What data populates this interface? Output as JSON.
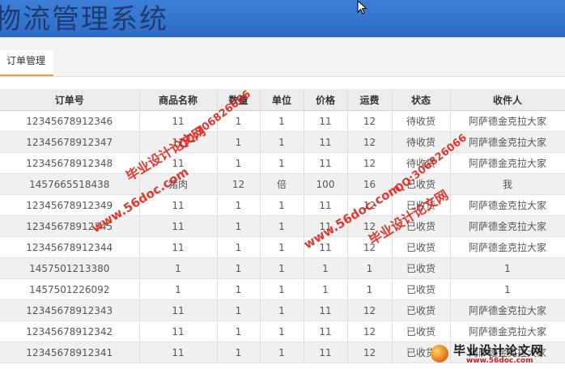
{
  "app": {
    "title": "物流管理系统"
  },
  "tabs": [
    {
      "label": "订单管理"
    }
  ],
  "table": {
    "columns": [
      "订单号",
      "商品名称",
      "数量",
      "单位",
      "价格",
      "运费",
      "状态",
      "收件人"
    ],
    "rows": [
      [
        "12345678912346",
        "11",
        "1",
        "1",
        "11",
        "12",
        "待收货",
        "阿萨德金克拉大家"
      ],
      [
        "12345678912347",
        "11",
        "1",
        "1",
        "11",
        "12",
        "待收货",
        "阿萨德金克拉大家"
      ],
      [
        "12345678912348",
        "11",
        "1",
        "1",
        "11",
        "12",
        "待收货",
        "阿萨德金克拉大家"
      ],
      [
        "1457665518438",
        "猪肉",
        "12",
        "倍",
        "100",
        "16",
        "已收货",
        "我"
      ],
      [
        "12345678912349",
        "11",
        "1",
        "1",
        "11",
        "12",
        "已收货",
        "阿萨德金克拉大家"
      ],
      [
        "12345678912345",
        "11",
        "1",
        "1",
        "11",
        "12",
        "已收货",
        "阿萨德金克拉大家"
      ],
      [
        "12345678912344",
        "11",
        "1",
        "1",
        "11",
        "12",
        "已收货",
        "阿萨德金克拉大家"
      ],
      [
        "1457501213380",
        "1",
        "1",
        "1",
        "1",
        "1",
        "已收货",
        "1"
      ],
      [
        "1457501226092",
        "1",
        "1",
        "1",
        "1",
        "1",
        "已收货",
        "1"
      ],
      [
        "12345678912343",
        "11",
        "1",
        "1",
        "11",
        "12",
        "已收货",
        "阿萨德金克拉大家"
      ],
      [
        "12345678912342",
        "11",
        "1",
        "1",
        "11",
        "12",
        "已收货",
        "阿萨德金克拉大家"
      ],
      [
        "12345678912341",
        "11",
        "1",
        "1",
        "11",
        "12",
        "已收货",
        "阿萨德金克拉大家"
      ]
    ]
  },
  "watermarks": {
    "site_name": "毕业设计论文网",
    "url": "www.56doc.com",
    "qq": "QQ:306826066",
    "logo_url": "www.56doc.com"
  },
  "colors": {
    "header_bg": "#2d6cc6",
    "tab_accent": "#e2a44a",
    "watermark": "#e0281e"
  }
}
